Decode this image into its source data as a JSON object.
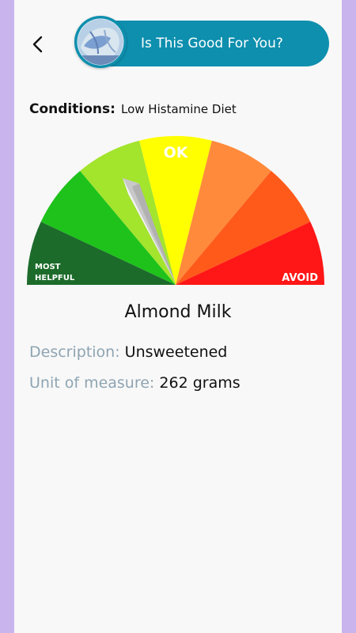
{
  "header": {
    "title": "Is This Good For You?"
  },
  "conditions": {
    "label": "Conditions:",
    "value": "Low Histamine Diet"
  },
  "gauge": {
    "left_label_line1": "MOST",
    "left_label_line2": "HELPFUL",
    "top_label": "OK",
    "right_label": "AVOID",
    "colors": [
      "#1d6b2b",
      "#1ec21b",
      "#a3e42d",
      "#ffff00",
      "#ff8a3c",
      "#ff5a1a",
      "#ff1616"
    ],
    "needle_color": "#d9d9d9"
  },
  "food": {
    "name": "Almond Milk",
    "description_label": "Description:",
    "description_value": "Unsweetened",
    "unit_label": "Unit of measure:",
    "unit_value": "262 grams"
  },
  "icons": {
    "back": "chevron-left-icon",
    "avatar": "food-image-icon"
  }
}
